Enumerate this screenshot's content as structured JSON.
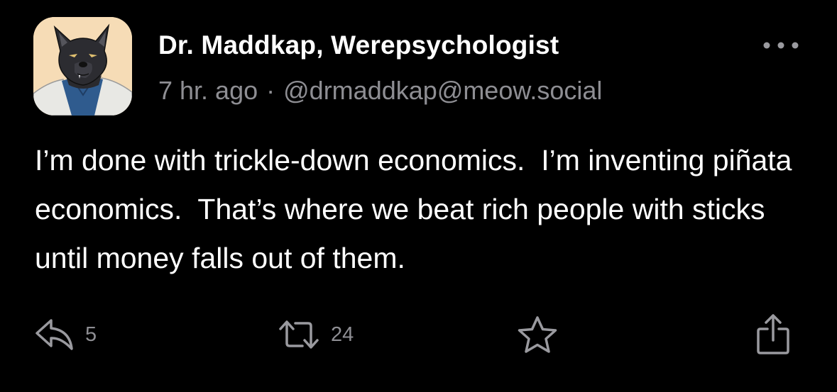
{
  "author": {
    "display_name": "Dr. Maddkap, Werepsychologist",
    "time_ago": "7 hr. ago",
    "separator": "·",
    "handle": "@drmaddkap@meow.social",
    "avatar": "wolf-avatar"
  },
  "post": {
    "text": "I’m done with trickle-down economics.  I’m inventing piñata economics.  That’s where we beat rich people with sticks until money falls out of them."
  },
  "actions": {
    "reply_count": "5",
    "boost_count": "24",
    "reply_icon": "reply-icon",
    "boost_icon": "boost-icon",
    "favourite_icon": "star-icon",
    "share_icon": "share-icon",
    "more_icon": "more-icon"
  },
  "colors": {
    "background": "#000000",
    "text": "#ffffff",
    "muted": "#8e8e93",
    "icon": "#9a9a9f"
  }
}
